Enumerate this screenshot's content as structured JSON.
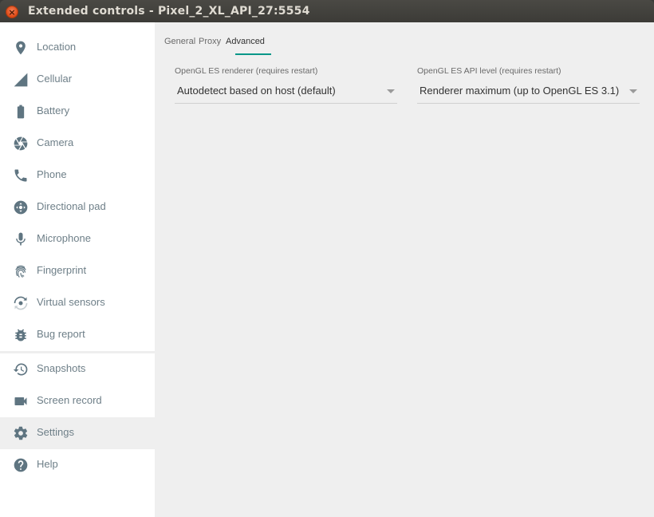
{
  "window": {
    "title": "Extended controls - Pixel_2_XL_API_27:5554",
    "close_glyph": "×"
  },
  "sidebar": {
    "items": [
      {
        "label": "Location",
        "icon": "location-pin-icon"
      },
      {
        "label": "Cellular",
        "icon": "cellular-signal-icon"
      },
      {
        "label": "Battery",
        "icon": "battery-icon"
      },
      {
        "label": "Camera",
        "icon": "camera-aperture-icon"
      },
      {
        "label": "Phone",
        "icon": "phone-icon"
      },
      {
        "label": "Directional pad",
        "icon": "dpad-icon"
      },
      {
        "label": "Microphone",
        "icon": "microphone-icon"
      },
      {
        "label": "Fingerprint",
        "icon": "fingerprint-icon"
      },
      {
        "label": "Virtual sensors",
        "icon": "rotation-icon"
      },
      {
        "label": "Bug report",
        "icon": "bug-icon"
      },
      {
        "label": "Snapshots",
        "icon": "history-icon"
      },
      {
        "label": "Screen record",
        "icon": "video-camera-icon"
      },
      {
        "label": "Settings",
        "icon": "gear-icon",
        "selected": true
      },
      {
        "label": "Help",
        "icon": "help-icon"
      }
    ]
  },
  "tabs": [
    {
      "label": "General"
    },
    {
      "label": "Proxy"
    },
    {
      "label": "Advanced",
      "active": true
    }
  ],
  "advanced": {
    "renderer": {
      "label": "OpenGL ES renderer (requires restart)",
      "value": "Autodetect based on host (default)"
    },
    "api_level": {
      "label": "OpenGL ES API level (requires restart)",
      "value": "Renderer maximum (up to OpenGL ES 3.1)"
    }
  },
  "colors": {
    "accent": "#009688",
    "icon": "#5f7581",
    "selected_bg": "#efefef"
  }
}
